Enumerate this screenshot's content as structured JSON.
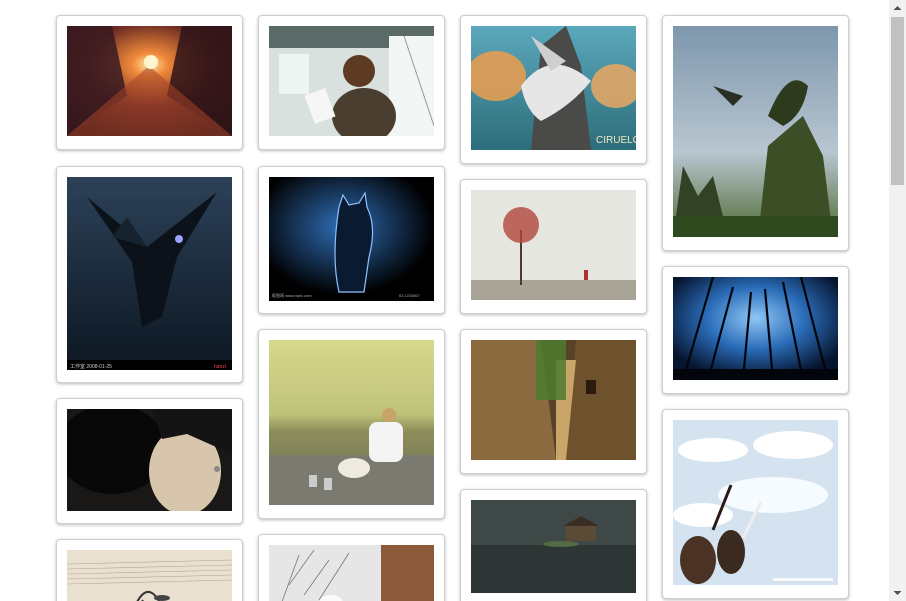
{
  "gallery": {
    "images": [
      {
        "subject": "city street at sunset",
        "palette": [
          "#3a1a1a",
          "#c84a1e",
          "#ffcf7a"
        ]
      },
      {
        "subject": "woman reading on a train",
        "palette": [
          "#dfe6e4",
          "#4a4a44",
          "#8c6b4a"
        ]
      },
      {
        "subject": "white dragon on rocky cliffs",
        "palette": [
          "#59a7b8",
          "#e8a55a",
          "#d9d9d9"
        ]
      },
      {
        "subject": "green dragon on mossy rock",
        "palette": [
          "#9fb3c4",
          "#3f5a2b",
          "#1e2a1a"
        ]
      },
      {
        "subject": "dark winged dragon in storm",
        "palette": [
          "#1b2b3c",
          "#0c1620",
          "#6f7cf0"
        ]
      },
      {
        "subject": "black cat in blue light",
        "palette": [
          "#000000",
          "#1d4f8c",
          "#a9c9f0"
        ]
      },
      {
        "subject": "lone red tree in fog",
        "palette": [
          "#e6e6e0",
          "#b0453a",
          "#8c8c80"
        ]
      },
      {
        "subject": "starry sky through tall trees",
        "palette": [
          "#0b2a5c",
          "#6fb4f0",
          "#000000"
        ]
      },
      {
        "subject": "girl with black cat",
        "palette": [
          "#141414",
          "#d9c9b0",
          "#5a4a3a"
        ]
      },
      {
        "subject": "man with dog at sunset",
        "palette": [
          "#c9c86a",
          "#8a8a60",
          "#ffffff"
        ]
      },
      {
        "subject": "old narrow stone alley",
        "palette": [
          "#8c6a3a",
          "#3a2a1a",
          "#5a7a3a"
        ]
      },
      {
        "subject": "two girls reaching to cloudy sky",
        "palette": [
          "#cfe0ee",
          "#ffffff",
          "#3a2a20"
        ]
      },
      {
        "subject": "music sheet with treble clef pendant",
        "palette": [
          "#e9e0d0",
          "#b0a090",
          "#2a2a2a"
        ]
      },
      {
        "subject": "bare branches with white cat",
        "palette": [
          "#e8e8e8",
          "#8a5a3a",
          "#c0c0c0"
        ]
      },
      {
        "subject": "small house floating on dark water",
        "palette": [
          "#3f4a48",
          "#2a3330",
          "#8a7a5a"
        ]
      }
    ],
    "captions": {
      "dragon_signature": "CIRUELO",
      "cat_watermark_left": "昵图网 www.nipic.com",
      "cat_watermark_right": "ID:1234567",
      "dragon2_watermark_left": "工作室  2008-01-25",
      "dragon2_watermark_right": "hanzi"
    }
  },
  "scrollbar": {
    "up_label": "scroll up",
    "down_label": "scroll down"
  }
}
